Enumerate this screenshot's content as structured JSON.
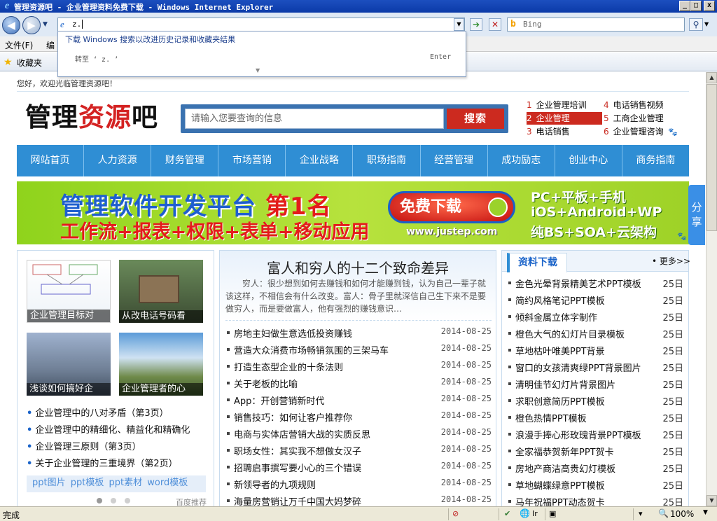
{
  "window": {
    "title": "管理资源吧 - 企业管理资料免费下载 - Windows Internet Explorer",
    "min": "_",
    "max": "□",
    "close": "x"
  },
  "browser": {
    "address_value": "z.",
    "search_placeholder": "Bing",
    "dropdown_hint": "下载 Windows 搜索以改进历史记录和收藏夹结果",
    "dropdown_goto": "转至 ‘ z. ’",
    "dropdown_enter": "Enter",
    "menu": [
      "文件(F)",
      "编"
    ],
    "favorites_label": "收藏夹",
    "status_text": "完成",
    "zoom": "100%"
  },
  "site": {
    "welcome": "您好，欢迎光临管理资源吧！",
    "logo_part1": "管理",
    "logo_part2": "资源",
    "logo_part3": "吧",
    "search_placeholder": "请输入您要查询的信息",
    "search_button": "搜索",
    "hot_searches": [
      {
        "num": "1",
        "text": "企业管理培训"
      },
      {
        "num": "2",
        "text": "企业管理",
        "selected": true
      },
      {
        "num": "3",
        "text": "电话销售"
      },
      {
        "num": "4",
        "text": "电话销售视频"
      },
      {
        "num": "5",
        "text": "工商企业管理"
      },
      {
        "num": "6",
        "text": "企业管理咨询"
      }
    ],
    "nav": [
      "网站首页",
      "人力资源",
      "财务管理",
      "市场营销",
      "企业战略",
      "职场指南",
      "经营管理",
      "成功励志",
      "创业中心",
      "商务指南"
    ],
    "banner": {
      "line1a": "管理软件开发平台 ",
      "line1b": "第1名",
      "line2": "工作流+报表+权限+表单+移动应用",
      "download": "免费下载",
      "url": "www.justep.com",
      "right1": "PC+平板+手机",
      "right2": "iOS+Android+WP",
      "right3": "纯BS+SOA+云架构"
    },
    "share": "分享",
    "thumbs": [
      "企业管理目标对",
      "从改电话号码看",
      "浅谈如何搞好企",
      "企业管理者的心"
    ],
    "left_list": [
      "企业管理中的八对矛盾（第3页）",
      "企业管理中的精细化、精益化和精确化",
      "企业管理三原则（第3页）",
      "关于企业管理的三重境界（第2页）"
    ],
    "tags": [
      "ppt图片",
      "ppt模板",
      "ppt素材",
      "word模板"
    ],
    "baidu_text": "百度推荐",
    "feature_title": "富人和穷人的十二个致命差异",
    "feature_summary": "穷人：很少想到如何去赚钱和如何才能赚到钱，认为自己一辈子就该这样，不相信会有什么改变。富人：骨子里就深信自己生下来不是要做穷人，而是要做富人，他有强烈的赚钱意识…",
    "articles": [
      {
        "title": "房地主妇做生意选低投资赚钱",
        "date": "2014-08-25"
      },
      {
        "title": "营造大众消费市场畅销氛围的三架马车",
        "date": "2014-08-25"
      },
      {
        "title": "打造生态型企业的十条法则",
        "date": "2014-08-25"
      },
      {
        "title": "关于老板的比喻",
        "date": "2014-08-25"
      },
      {
        "title": "App：开创营销新时代",
        "date": "2014-08-25"
      },
      {
        "title": "销售技巧：如何让客户推荐你",
        "date": "2014-08-25"
      },
      {
        "title": "电商与实体店营销大战的实质反思",
        "date": "2014-08-25"
      },
      {
        "title": "职场女性：其实我不想做女汉子",
        "date": "2014-08-25"
      },
      {
        "title": "招聘启事撰写要小心的三个错误",
        "date": "2014-08-25"
      },
      {
        "title": "新领导者的九项规则",
        "date": "2014-08-25"
      },
      {
        "title": "海量房营销让万千中国大妈梦碎",
        "date": "2014-08-25"
      }
    ],
    "downloads_tab": "资料下载",
    "downloads_more": "• 更多>>",
    "downloads": [
      {
        "title": "金色光晕背景精美艺术PPT模板",
        "date": "25日"
      },
      {
        "title": "简约风格笔记PPT模板",
        "date": "25日"
      },
      {
        "title": "倾斜金属立体字制作",
        "date": "25日"
      },
      {
        "title": "橙色大气的幻灯片目录模板",
        "date": "25日"
      },
      {
        "title": "草地枯叶唯美PPT背景",
        "date": "25日"
      },
      {
        "title": "窗口的女孩清爽绿PPT背景图片",
        "date": "25日"
      },
      {
        "title": "清明佳节幻灯片背景图片",
        "date": "25日"
      },
      {
        "title": "求职创意简历PPT模板",
        "date": "25日"
      },
      {
        "title": "橙色热情PPT模板",
        "date": "25日"
      },
      {
        "title": "浪漫手捧心形玫瑰背景PPT模板",
        "date": "25日"
      },
      {
        "title": "全家福恭贺新年PPT贺卡",
        "date": "25日"
      },
      {
        "title": "房地产商洁高贵幻灯模板",
        "date": "25日"
      },
      {
        "title": "草地蝴蝶绿意PPT模板",
        "date": "25日"
      },
      {
        "title": "马年祝福PPT动态贺卡",
        "date": "25日"
      }
    ]
  }
}
